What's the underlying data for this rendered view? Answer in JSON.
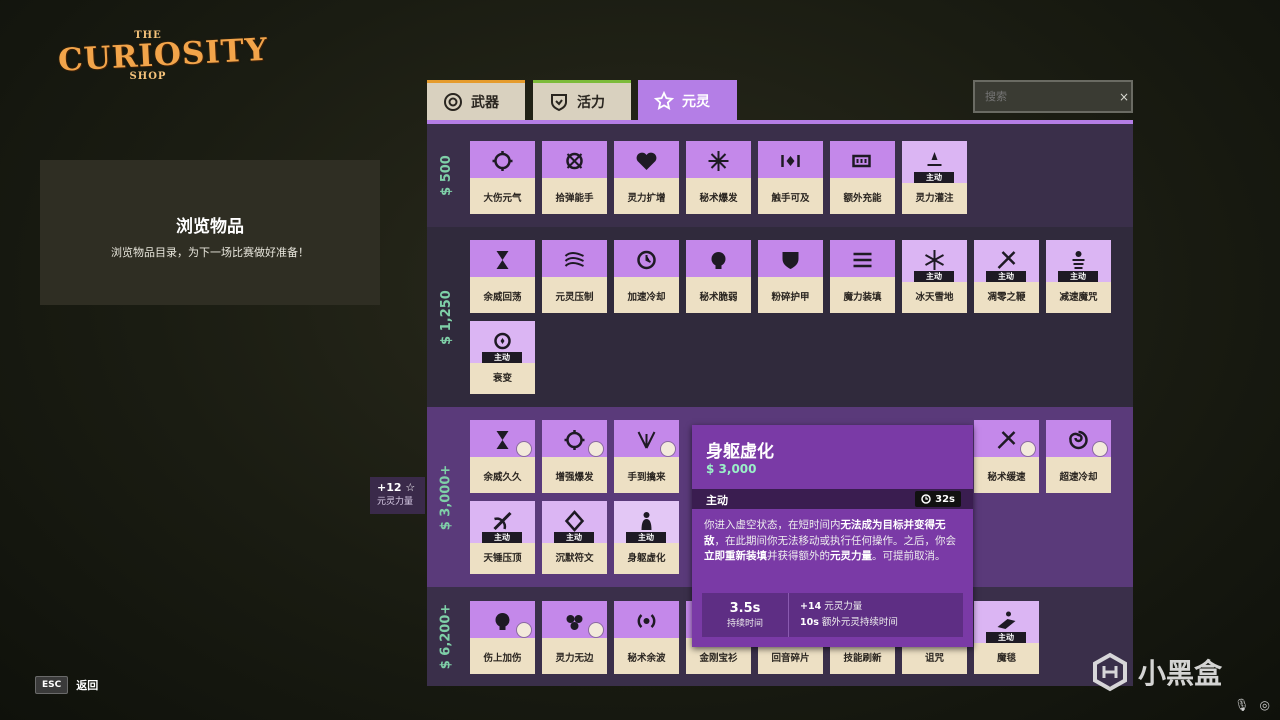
{
  "logo": {
    "the": "THE",
    "main": "CURIOSITY",
    "shop": "SHOP"
  },
  "info": {
    "title": "浏览物品",
    "subtitle": "浏览物品目录，为下一场比赛做好准备！"
  },
  "tabs": [
    {
      "label": "武器",
      "icon": "weapon-icon",
      "accent": "#e59b2c"
    },
    {
      "label": "活力",
      "icon": "vitality-icon",
      "accent": "#7cbb3a"
    },
    {
      "label": "元灵",
      "icon": "spirit-star-icon",
      "accent": "#b47ee6"
    }
  ],
  "search": {
    "placeholder": "搜索",
    "clear": "×"
  },
  "tiers": [
    {
      "price": "500",
      "items": [
        {
          "name": "大伤元气"
        },
        {
          "name": "拾弹能手"
        },
        {
          "name": "灵力扩增"
        },
        {
          "name": "秘术爆发"
        },
        {
          "name": "触手可及"
        },
        {
          "name": "额外充能"
        },
        {
          "name": "灵力灌注",
          "badge": "主动"
        }
      ]
    },
    {
      "price": "1,250",
      "items": [
        {
          "name": "余威回荡"
        },
        {
          "name": "元灵压制"
        },
        {
          "name": "加速冷却"
        },
        {
          "name": "秘术脆弱"
        },
        {
          "name": "粉碎护甲"
        },
        {
          "name": "魔力装填"
        },
        {
          "name": "冰天雪地",
          "badge": "主动"
        },
        {
          "name": "凋零之鞭",
          "badge": "主动"
        },
        {
          "name": "减速魔咒",
          "badge": "主动"
        },
        {
          "name": "衰变",
          "badge": "主动"
        }
      ]
    },
    {
      "price": "3,000+",
      "items": [
        {
          "name": "余威久久"
        },
        {
          "name": "增强爆发"
        },
        {
          "name": "手到擒来"
        },
        {
          "name": "秘术缓速"
        },
        {
          "name": "超速冷却"
        },
        {
          "name": "天锤压顶",
          "badge": "主动"
        },
        {
          "name": "沉默符文",
          "badge": "主动"
        },
        {
          "name": "身躯虚化",
          "badge": "主动"
        }
      ]
    },
    {
      "price": "6,200+",
      "items": [
        {
          "name": "伤上加伤"
        },
        {
          "name": "灵力无边"
        },
        {
          "name": "秘术余波"
        },
        {
          "name": "金刚宝衫"
        },
        {
          "name": "回音碎片"
        },
        {
          "name": "技能刷新"
        },
        {
          "name": "诅咒"
        },
        {
          "name": "魔毯",
          "badge": "主动"
        }
      ]
    }
  ],
  "tooltip": {
    "title": "身躯虚化",
    "price": "3,000",
    "type": "主动",
    "cooldown": "32s",
    "desc_1": "你进入虚空状态，在短时间内",
    "desc_b1": "无法成为目标并变得无敌",
    "desc_2": "，在此期间你无法移动或执行任何操作。之后，你会",
    "desc_b2": "立即重新装填",
    "desc_3": "并获得额外的",
    "desc_b3": "元灵力量",
    "desc_4": "。可提前取消。",
    "duration_value": "3.5s",
    "duration_label": "持续时间",
    "stat1_value": "+14",
    "stat1_label": "元灵力量",
    "stat2_value": "10s",
    "stat2_label": "额外元灵持续时间"
  },
  "bonus": {
    "value": "+12",
    "label": "元灵力量"
  },
  "esc": {
    "key": "ESC",
    "label": "返回"
  },
  "watermark": {
    "text": "小黑盒"
  },
  "colors": {
    "accent": "#b47ee6",
    "price": "#7fd0a8",
    "tooltip": "#7a3aa6"
  }
}
